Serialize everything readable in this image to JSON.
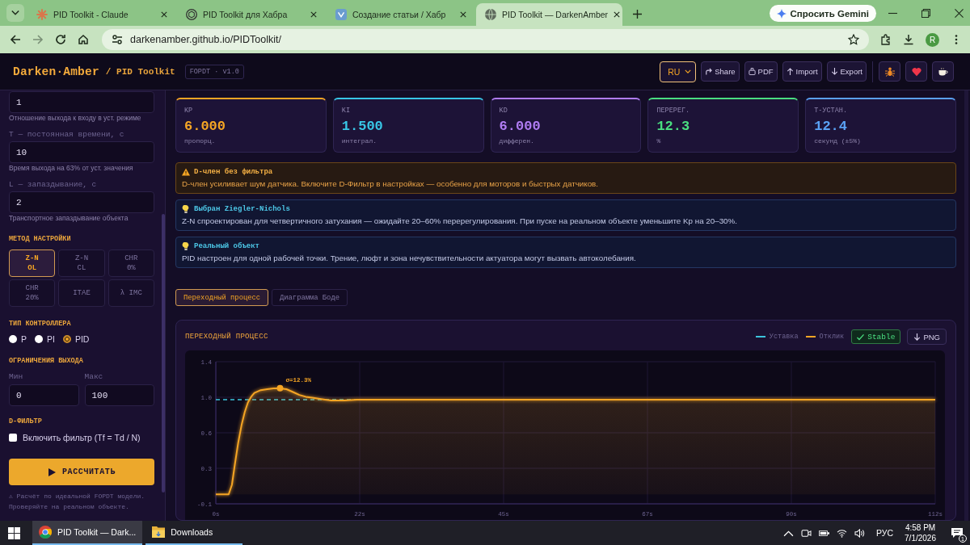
{
  "browser": {
    "tabs": [
      {
        "title": "PID Toolkit - Claude",
        "selected": false
      },
      {
        "title": "PID Toolkit для Хабра",
        "selected": false
      },
      {
        "title": "Создание статьи / Хабр",
        "selected": false
      },
      {
        "title": "PID Toolkit — DarkenAmber",
        "selected": true
      }
    ],
    "gemini_button": "Спросить Gemini",
    "url": "darkenamber.github.io/PIDToolkit/",
    "profile_initial": "R"
  },
  "header": {
    "logo": "Darken·Amber",
    "subtitle": "/ PID Toolkit",
    "version": "FOPDT · v1.0",
    "language": "RU",
    "actions": [
      "Share",
      "PDF",
      "Import",
      "Export"
    ]
  },
  "sidebar": {
    "params": [
      {
        "value": "1",
        "hint": "Отношение выхода к входу в уст. режиме"
      },
      {
        "label": "T — постоянная времени, с",
        "value": "10",
        "hint": "Время выхода на 63% от уст. значения"
      },
      {
        "label": "L — запаздывание, с",
        "value": "2",
        "hint": "Транспортное запаздывание объекта"
      }
    ],
    "method": {
      "title": "МЕТОД НАСТРОЙКИ",
      "options": [
        {
          "lines": [
            "Z-N",
            "OL"
          ],
          "selected": true
        },
        {
          "lines": [
            "Z-N",
            "CL"
          ],
          "selected": false
        },
        {
          "lines": [
            "CHR",
            "0%"
          ],
          "selected": false
        },
        {
          "lines": [
            "CHR",
            "20%"
          ],
          "selected": false
        },
        {
          "lines": [
            "ITAE"
          ],
          "selected": false
        },
        {
          "lines": [
            "λ IMC"
          ],
          "selected": false
        }
      ]
    },
    "controller": {
      "title": "ТИП КОНТРОЛЛЕРА",
      "options": [
        {
          "label": "P",
          "selected": false
        },
        {
          "label": "PI",
          "selected": false
        },
        {
          "label": "PID",
          "selected": true
        }
      ]
    },
    "limits": {
      "title": "ОГРАНИЧЕНИЯ ВЫХОДА",
      "fields": [
        {
          "label": "Мин",
          "value": "0"
        },
        {
          "label": "Макс",
          "value": "100"
        }
      ]
    },
    "d_filter": {
      "title": "D-ФИЛЬТР",
      "label": "Включить фильтр (Tf = Td / N)",
      "checked": false
    },
    "calculate_button": "РАССЧИТАТЬ",
    "note": "⚠ Расчёт по идеальной FOPDT модели. Проверяйте на реальном объекте."
  },
  "metrics": [
    {
      "label": "KP",
      "value": "6.000",
      "unit": "пропорц.",
      "color": "#f5a524"
    },
    {
      "label": "KI",
      "value": "1.500",
      "unit": "интеграл.",
      "color": "#38c6e6"
    },
    {
      "label": "KD",
      "value": "6.000",
      "unit": "дифферен.",
      "color": "#b07cf2"
    },
    {
      "label": "ПЕРЕРЕГ.",
      "value": "12.3",
      "unit": "%",
      "color": "#4ade80"
    },
    {
      "label": "Т-УСТАН.",
      "value": "12.4",
      "unit": "секунд (±5%)",
      "color": "#5aa2f5"
    }
  ],
  "alerts": [
    {
      "kind": "warning",
      "title": "D-член без фильтра",
      "text": "D-член усиливает шум датчика. Включите D-Фильтр в настройках — особенно для моторов и быстрых датчиков."
    },
    {
      "kind": "tip",
      "title": "Выбран Ziegler-Nichols",
      "text": "Z-N спроектирован для четвертичного затухания — ожидайте 20–60% перерегулирования. При пуске на реальном объекте уменьшите Kp на 20–30%."
    },
    {
      "kind": "tip",
      "title": "Реальный объект",
      "text": "PID настроен для одной рабочей точки. Трение, люфт и зона нечувствительности актуатора могут вызвать автоколебания."
    }
  ],
  "view_tabs": [
    {
      "label": "Переходный процесс",
      "selected": true
    },
    {
      "label": "Диаграмма Боде",
      "selected": false
    }
  ],
  "chart_panel": {
    "status": "Stable",
    "export_button": "PNG",
    "chart_data": {
      "type": "area",
      "title": "ПЕРЕХОДНЫЙ ПРОЦЕСС",
      "x": [
        0,
        1,
        2,
        2.5,
        3,
        3.5,
        4,
        4.5,
        5,
        5.5,
        6,
        7,
        8,
        9,
        10,
        11,
        12,
        13,
        14,
        15,
        16,
        17,
        18,
        19,
        20,
        22,
        24,
        26,
        28,
        30,
        40,
        50,
        60,
        70,
        80,
        90,
        100,
        112
      ],
      "series": [
        {
          "name": "Отклик",
          "color": "#f5a524",
          "values": [
            0,
            0,
            0,
            0.1,
            0.33,
            0.55,
            0.73,
            0.87,
            0.97,
            1.03,
            1.07,
            1.1,
            1.11,
            1.12,
            1.12,
            1.11,
            1.08,
            1.05,
            1.03,
            1.02,
            1.01,
            1,
            0.99,
            0.99,
            0.99,
            1,
            1,
            1,
            1,
            1,
            1,
            1,
            1,
            1,
            1,
            1,
            1,
            1
          ]
        }
      ],
      "ref_lines": [
        {
          "axis": "y",
          "value": 1,
          "label": "Уставка",
          "color": "#3cc3dc",
          "line_style": "dashed"
        }
      ],
      "xlim": [
        0,
        112
      ],
      "ylim": [
        -0.1,
        1.4
      ],
      "xticks": [
        {
          "value": 0,
          "label": "0s"
        },
        {
          "value": 22.4,
          "label": "22s"
        },
        {
          "value": 44.8,
          "label": "45s"
        },
        {
          "value": 67.2,
          "label": "67s"
        },
        {
          "value": 89.6,
          "label": "90s"
        },
        {
          "value": 112,
          "label": "112s"
        }
      ],
      "yticks": [
        {
          "value": -0.1,
          "label": "-0.1"
        },
        {
          "value": 0.275,
          "label": "0.3"
        },
        {
          "value": 0.65,
          "label": "0.6"
        },
        {
          "value": 1.025,
          "label": "1.0"
        },
        {
          "value": 1.4,
          "label": "1.4"
        }
      ],
      "grid": true,
      "annotations": [
        {
          "x": 10,
          "y": 1.12,
          "text": "σ=12.3%"
        }
      ]
    }
  },
  "taskbar": {
    "items": [
      {
        "label": "PID Toolkit — Dark...",
        "selected": true
      },
      {
        "label": "Downloads",
        "selected": false
      }
    ],
    "language": "РУС",
    "time": "4:58 PM",
    "date": "7/1/2026",
    "notifications": "1"
  }
}
